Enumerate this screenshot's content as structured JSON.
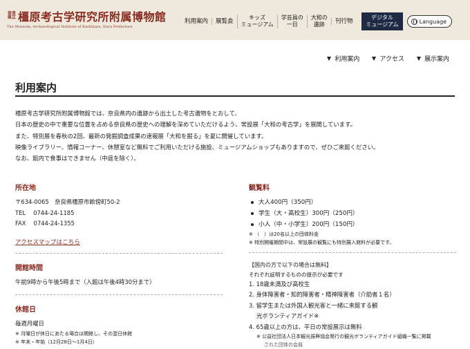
{
  "header": {
    "logo_prefix": [
      "奈良",
      "県立"
    ],
    "logo_name": "橿原考古学研究所附属博物館",
    "logo_sub": "The Museum, Archaeological Institute of Kashihara, Nara Prefecture",
    "nav": [
      {
        "lines": [
          "利用案内"
        ]
      },
      {
        "lines": [
          "展覧会"
        ]
      },
      {
        "lines": [
          "キッズ",
          "ミュージアム"
        ]
      },
      {
        "lines": [
          "学芸員の",
          "一日"
        ]
      },
      {
        "lines": [
          "大和の",
          "遺跡"
        ]
      },
      {
        "lines": [
          "刊行物"
        ]
      }
    ],
    "digital": [
      "デジタル",
      "ミュージアム"
    ],
    "language": "Language"
  },
  "localnav": [
    "利用案内",
    "アクセス",
    "展示案内"
  ],
  "page_title": "利用案内",
  "intro": [
    "橿原考古学研究所附属博物館では、奈良県内の遺跡から出土した考古遺物をとおして、",
    "日本の歴史の中で重要な位置を占める奈良県の歴史への理解を深めていただけるよう、常設展「大和の考古学」を展開しています。",
    "また、特別展を春秋の2回、最新の発掘調査成果の速報展「大和を掘る」を夏に開催しています。",
    "映像ライブラリー、情報コーナー、休憩室など無料でご利用いただける施設、ミュージアムショップもありますので、ぜひご来館ください。",
    "なお、館内で食事はできません（中庭を除く）。"
  ],
  "location": {
    "title": "所在地",
    "address": "〒634-0065　奈良県橿原市畝傍町50-2",
    "tel": "TEL　 0744-24-1185",
    "fax": "FAX　 0744-24-1355",
    "map_link": "アクセスマップはこちら"
  },
  "hours": {
    "title": "開館時間",
    "text": "午前9時から午後5時まで（入館は午後4時30分まで）"
  },
  "closed": {
    "title": "休館日",
    "text": "毎週月曜日",
    "notes": [
      "※ 月曜日が休日にあたる場合は開館し、その翌日休館",
      "※ 年末・年始（12月28日～1月4日）"
    ]
  },
  "admission": {
    "title": "観覧料",
    "items": [
      "大人400円（350円）",
      "学生（大・高校生）300円（250円）",
      "小人（中・小学生）200円（150円）"
    ],
    "notes": [
      "※ （　）は20名以上の団体料金",
      "※ 特別開催期間中は、常設展の観覧にも特別展入館料が必要です。"
    ],
    "free_title": "【国内の方で以下の場合は無料】",
    "free_sub": "それぞれ証明するものの提示が必要です",
    "free_items": [
      {
        "lines": [
          "1. 18歳未満及び高校生"
        ]
      },
      {
        "lines": [
          "2. 身体障害者・知的障害者・精神障害者（介助者１名）"
        ]
      },
      {
        "lines": [
          "3. 留学生または外国人観光客と一緒に来館する観",
          "光ボランティアガイド※"
        ]
      },
      {
        "lines": [
          "4. 65歳以上の方は、平日の常設展示は無料"
        ]
      }
    ],
    "free_note": [
      "※ 公益社団法人日本観光振興協会発行の観光ボランティアガイド組織一覧に掲載",
      "された団体の会員"
    ]
  }
}
